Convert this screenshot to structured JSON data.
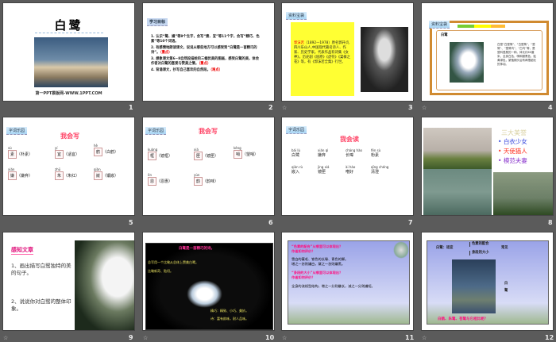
{
  "slides": [
    {
      "number": "1",
      "title": "白鹭",
      "footer": "第一PPT模板网-WWW.1PPT.COM"
    },
    {
      "number": "2",
      "tag": "学习目标",
      "items": [
        {
          "text": "1. 认识“鹭、嫌”等9个生字，会写“素、宜”等11个字，会写“精巧、色素”等10个词语。",
          "note": ""
        },
        {
          "text": "2. 有感情地朗读课文，说说从哪些地方可以感受到“白鹭是一首精巧的诗”。",
          "note": "（重点）"
        },
        {
          "text": "3. 想象课文第6~8自然段描绘的三幅优美的图画，感受白鹭的美，体会作者对白鹭的喜爱与赞美之情。",
          "note": "（重点）"
        },
        {
          "text": "4. 背诵课文，抄写自己喜欢的自然段。",
          "note": "（难点）"
        }
      ]
    },
    {
      "number": "3",
      "tag": "资料宝袋",
      "name": "郭沫若",
      "bio": "（1892—1978）原名郭开贞,四川乐山人,中国现代著名诗人、作家、历史学家。代表作品有诗集《女神》，历史剧《屈原》《虎符》《棠棣之花》等，有《郭沫若全集》行世。"
    },
    {
      "number": "4",
      "tag": "资料宝袋",
      "heading": "白鹭",
      "desc": "白鹭“白鹭鸶”、“白鹭鸶”、“鹭鸶”、“鹭鸶鸟”、“白鸟”等，是鹭科鹭属的一种。体长约60厘米，全身白色，嘴和腿黑色，趾黄绿色，繁殖期头后有两根细长的饰羽。"
    },
    {
      "number": "5",
      "tag": "字词乐园",
      "heading": "我会写",
      "words": [
        {
          "py": "sù",
          "ch": "素",
          "w": "（朴素）"
        },
        {
          "py": "yí",
          "ch": "宜",
          "w": "（适宜）"
        },
        {
          "py": "hè",
          "ch": "鹤",
          "w": "（白鹤）"
        },
        {
          "py": "xián",
          "ch": "嫌",
          "w": "（嫌弃）"
        },
        {
          "py": "zhū",
          "ch": "朱",
          "w": "（朱红）"
        },
        {
          "py": "qiàn",
          "ch": "嵌",
          "w": "（镶嵌）"
        }
      ]
    },
    {
      "number": "6",
      "tag": "字词乐园",
      "heading": "我会写",
      "words": [
        {
          "py": "kuàng",
          "ch": "框",
          "w": "（镜框）"
        },
        {
          "py": "xiá",
          "ch": "匣",
          "w": "（镜匣）"
        },
        {
          "py": "kěng",
          "ch": "哨",
          "w": "（望哨）"
        },
        {
          "py": "ēn",
          "ch": "恩",
          "w": "（恩惠）"
        },
        {
          "py": "yùn",
          "ch": "韵",
          "w": "（韵味）"
        }
      ]
    },
    {
      "number": "7",
      "tag": "字词乐园",
      "heading": "我会读",
      "words": [
        {
          "py": "bái lù",
          "w": "白鹭"
        },
        {
          "py": "xián qì",
          "w": "嫌弃"
        },
        {
          "py": "cháng hào",
          "w": "长嗥"
        },
        {
          "py": "fěn sù",
          "w": "粉素"
        },
        {
          "py": "qiàn rù",
          "w": "嵌入"
        },
        {
          "py": "jìng xiá",
          "w": "镜匣"
        },
        {
          "py": "ài hào",
          "w": "嗜好"
        },
        {
          "py": "qīng chéng",
          "w": "清澄"
        }
      ]
    },
    {
      "number": "8",
      "title": "三大美誉",
      "items": [
        "白衣少女",
        "天使猫人",
        "模范夫妻"
      ],
      "colors": [
        "#3344dd",
        "#ff3322",
        "#8833cc"
      ]
    },
    {
      "number": "9",
      "title": "感知文章",
      "q1": "1、画出描写白鹭独特的美的句子。",
      "q2": "2、说说你对白鹭的整体印象。"
    },
    {
      "number": "10",
      "title": "白鹭是一首精巧的诗。",
      "l1": "总写用一个比喻从总体上赞美白鹭。",
      "l2": "比喻新奇、贴切。",
      "l3": "精巧：精致、小巧、美妙。",
      "l4": "诗：富有韵味，耐人品味。"
    },
    {
      "number": "11",
      "q1": "“色素的配合”从哪里可以体现出？",
      "q1b": "作者如何评价？",
      "a1": "雪白的蓑毛、铁色的长喙、青色的脚。",
      "a1b": "增之一忽则嫌白，黛之一忽则嫌黑。",
      "q2": "“身段的大小”从哪里可以体现出？",
      "q2b": "作者如何评价？",
      "a2": "全身的流线型结构，增之一分则嫌长，减之一分则嫌短。"
    },
    {
      "number": "12",
      "label": "白鹭：适宜",
      "b1": "色素的配合",
      "b2": "身段的大小",
      "right": "常见",
      "side": "白鹭",
      "bottom": "白鹤、朱鹭、苍鹭与它相比呢？"
    }
  ]
}
